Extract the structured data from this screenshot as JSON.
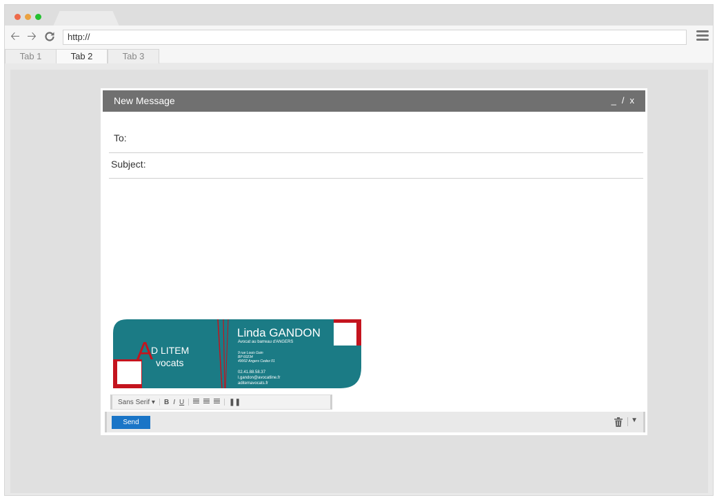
{
  "browser": {
    "url": "http://",
    "tabs": [
      {
        "label": "Tab 1"
      },
      {
        "label": "Tab 2"
      },
      {
        "label": "Tab 3"
      }
    ],
    "active_tab": 1,
    "dot_colors": {
      "red": "#ee6a4a",
      "yellow": "#eba241",
      "green": "#25c131"
    },
    "icons": [
      "back-icon",
      "forward-icon",
      "reload-icon",
      "menu-icon"
    ]
  },
  "compose": {
    "title": "New Message",
    "controls": {
      "minimize": "_",
      "maximize": "/",
      "close": "x"
    },
    "to_label": "To:",
    "subject_label": "Subject:",
    "signature": {
      "logo_line1": "D LITEM",
      "logo_line2": "vocats",
      "logo_letter": "A",
      "name": "Linda GANDON",
      "role": "Avocat au barreau d'ANGERS",
      "address": [
        "9 rue Louis Gain",
        "BP 60234",
        "49002 Angers Cedex 01"
      ],
      "contact": [
        "02.41.88.58.37",
        "l.gandon@avocatline.fr",
        "aditemavocats.fr"
      ],
      "colors": {
        "teal": "#1b7b85",
        "red": "#c4141e"
      }
    },
    "format_bar": {
      "font": "Sans Serif",
      "bold": "B",
      "italic": "I",
      "underline": "U"
    },
    "send_label": "Send",
    "accent": "#1a75c7"
  }
}
